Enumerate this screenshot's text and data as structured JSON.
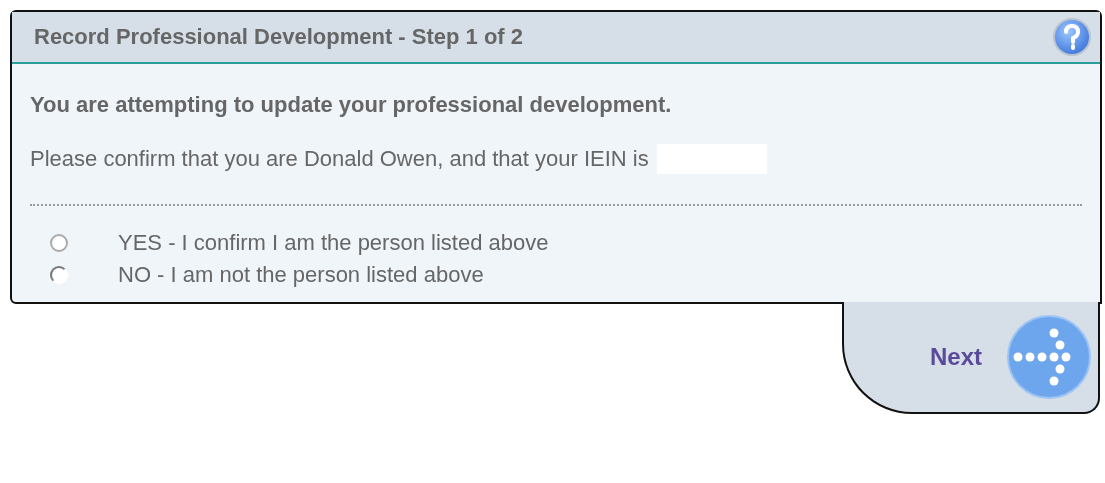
{
  "panel": {
    "title": "Record Professional Development - Step 1 of 2"
  },
  "intro": "You are attempting to update your professional development.",
  "confirm_text": "Please confirm that you are Donald Owen, and that your IEIN is",
  "options": [
    {
      "label": "YES - I confirm I am the person listed above",
      "selected": false,
      "disabled": false
    },
    {
      "label": "NO - I am not the person listed above",
      "selected": false,
      "disabled": true
    }
  ],
  "next_button": {
    "label": "Next"
  }
}
